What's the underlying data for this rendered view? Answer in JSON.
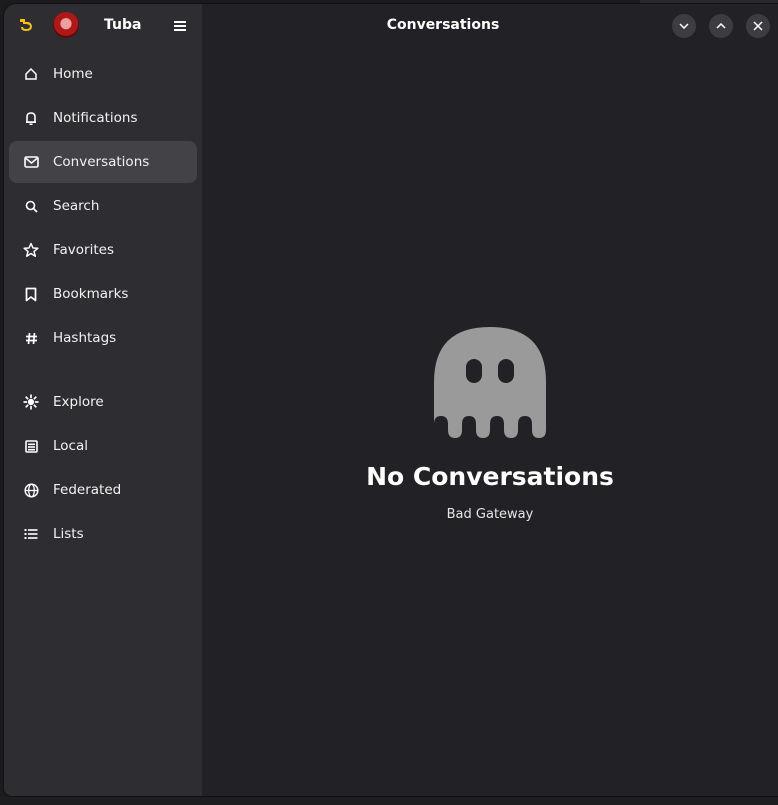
{
  "app": {
    "name": "Tuba"
  },
  "account": {
    "name": "Tuba"
  },
  "header": {
    "title": "Conversations"
  },
  "nav": {
    "items": [
      {
        "label": "Home",
        "icon": "home-icon"
      },
      {
        "label": "Notifications",
        "icon": "bell-icon"
      },
      {
        "label": "Conversations",
        "icon": "mail-icon",
        "active": true
      },
      {
        "label": "Search",
        "icon": "search-icon"
      },
      {
        "label": "Favorites",
        "icon": "star-icon"
      },
      {
        "label": "Bookmarks",
        "icon": "bookmark-icon"
      },
      {
        "label": "Hashtags",
        "icon": "hashtag-icon"
      },
      {
        "label": "Explore",
        "icon": "explore-icon"
      },
      {
        "label": "Local",
        "icon": "local-icon"
      },
      {
        "label": "Federated",
        "icon": "globe-icon"
      },
      {
        "label": "Lists",
        "icon": "list-icon"
      }
    ]
  },
  "empty_state": {
    "title": "No Conversations",
    "subtitle": "Bad Gateway",
    "icon": "ghost-icon"
  },
  "colors": {
    "sidebar": "#2e2e32",
    "content": "#222226",
    "active_item": "#434347",
    "ghost": "#9a9a9a"
  }
}
